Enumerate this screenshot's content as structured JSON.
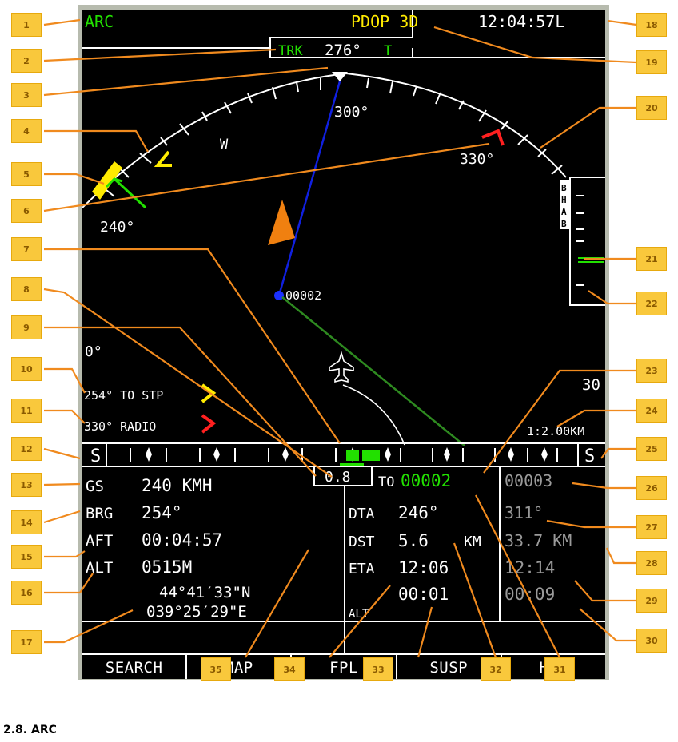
{
  "header": {
    "mode": "ARC",
    "pdop": "PDOP 3D",
    "time": "12:04:57L"
  },
  "track": {
    "label": "TRK",
    "value": "276°",
    "suffix": "T"
  },
  "compass": {
    "tick_300": "300°",
    "tick_330": "330°",
    "tick_240": "240°",
    "west": "W"
  },
  "waypoint": {
    "label": "00002"
  },
  "left_panel": {
    "hdg_fragment": "0°",
    "stp": "254° TO STP",
    "radio": "330° RADIO"
  },
  "right_panel": {
    "range_top": "30",
    "scale": "1:2.00KM",
    "scale_letters": [
      "B",
      "H",
      "A",
      "B"
    ]
  },
  "tape": {
    "left_mark": "S",
    "right_mark": "S",
    "deviation": "0.8"
  },
  "data": {
    "gs_label": "GS",
    "gs_value": "240 KMH",
    "brg_label": "BRG",
    "brg_value": "254°",
    "aft_label": "AFT",
    "aft_value": "00:04:57",
    "alt_label": "ALT",
    "alt_value": "0515M",
    "lat": "44°41′33\"N",
    "lon": "039°25′29\"E"
  },
  "mid": {
    "to_label": "TO",
    "to_value": "00002",
    "dta_label": "DTA",
    "dta_value": "246°",
    "dst_label": "DST",
    "dst_value": "5.6",
    "dst_unit": "KM",
    "eta_label": "ETA",
    "eta_value": "12:06",
    "ete_value": "00:01",
    "alt_label": "ALT"
  },
  "next": {
    "wp": "00003",
    "dta": "311°",
    "dst": "33.7 KM",
    "eta": "12:14",
    "ete": "00:09"
  },
  "softkeys": [
    "SEARCH",
    "MAP",
    "FPL",
    "SUSP",
    "HSI"
  ],
  "caption": "2.8. ARC",
  "callouts": [
    "1",
    "2",
    "3",
    "4",
    "5",
    "6",
    "7",
    "8",
    "9",
    "10",
    "11",
    "12",
    "13",
    "14",
    "15",
    "16",
    "17",
    "18",
    "19",
    "20",
    "21",
    "22",
    "23",
    "24",
    "25",
    "26",
    "27",
    "28",
    "29",
    "30",
    "31",
    "32",
    "33",
    "34",
    "35"
  ],
  "colors": {
    "accent": "#f9c83c",
    "green": "#22e000",
    "yellow": "#ffeb00",
    "orange": "#f08010"
  }
}
